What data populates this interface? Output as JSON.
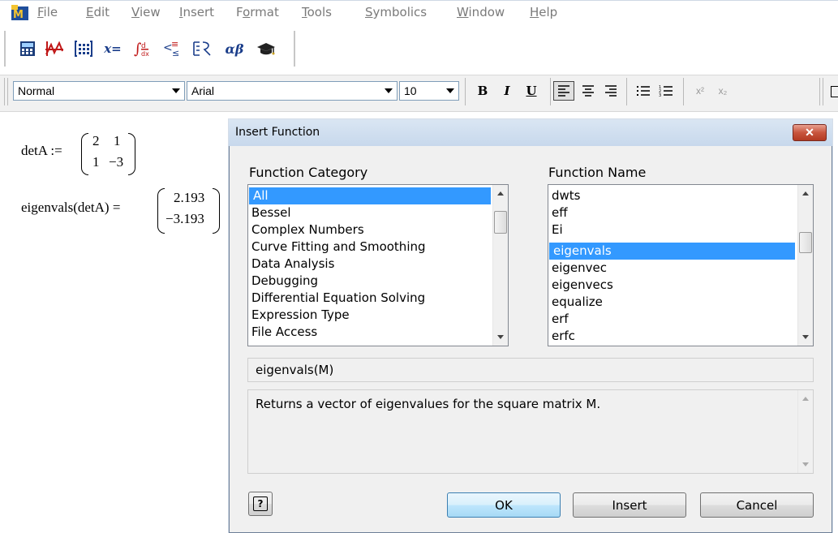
{
  "menubar": {
    "items": [
      {
        "label": "File",
        "u": "F",
        "rest": "ile"
      },
      {
        "label": "Edit",
        "u": "E",
        "rest": "dit"
      },
      {
        "label": "View",
        "u": "V",
        "rest": "iew"
      },
      {
        "label": "Insert",
        "u": "I",
        "rest": "nsert"
      },
      {
        "label": "Format",
        "u": "o",
        "pre": "F",
        "rest": "rmat"
      },
      {
        "label": "Tools",
        "u": "T",
        "rest": "ools"
      },
      {
        "label": "Symbolics",
        "u": "S",
        "rest": "ymbolics"
      },
      {
        "label": "Window",
        "u": "W",
        "rest": "indow"
      },
      {
        "label": "Help",
        "u": "H",
        "rest": "elp"
      }
    ]
  },
  "math_toolbar": {
    "xeq": "x=",
    "alphabeta": "αβ"
  },
  "format_toolbar": {
    "style": "Normal",
    "font": "Arial",
    "size": "10",
    "bold": "B",
    "italic": "I",
    "underline": "U",
    "superscript": "x²",
    "subscript": "x₂"
  },
  "worksheet": {
    "def_lhs": "detA :=",
    "matrix": [
      [
        "2",
        "1"
      ],
      [
        "1",
        "−3"
      ]
    ],
    "eval_lhs": "eigenvals(detA) =",
    "result": [
      "2.193",
      "−3.193"
    ]
  },
  "dialog": {
    "title": "Insert Function",
    "close_label": "✕",
    "category_label": "Function Category",
    "name_label": "Function Name",
    "categories": [
      "All",
      "Bessel",
      "Complex Numbers",
      "Curve Fitting and Smoothing",
      "Data Analysis",
      "Debugging",
      "Differential Equation Solving",
      "Expression Type",
      "File Access"
    ],
    "selected_category": "All",
    "functions": [
      "dwts",
      "eff",
      "Ei",
      "eigenvals",
      "eigenvec",
      "eigenvecs",
      "equalize",
      "erf",
      "erfc"
    ],
    "selected_function": "eigenvals",
    "signature": "eigenvals(M)",
    "description": "Returns a vector of eigenvalues for the square matrix M.",
    "help_label": "?",
    "ok_label": "OK",
    "insert_label": "Insert",
    "cancel_label": "Cancel"
  }
}
